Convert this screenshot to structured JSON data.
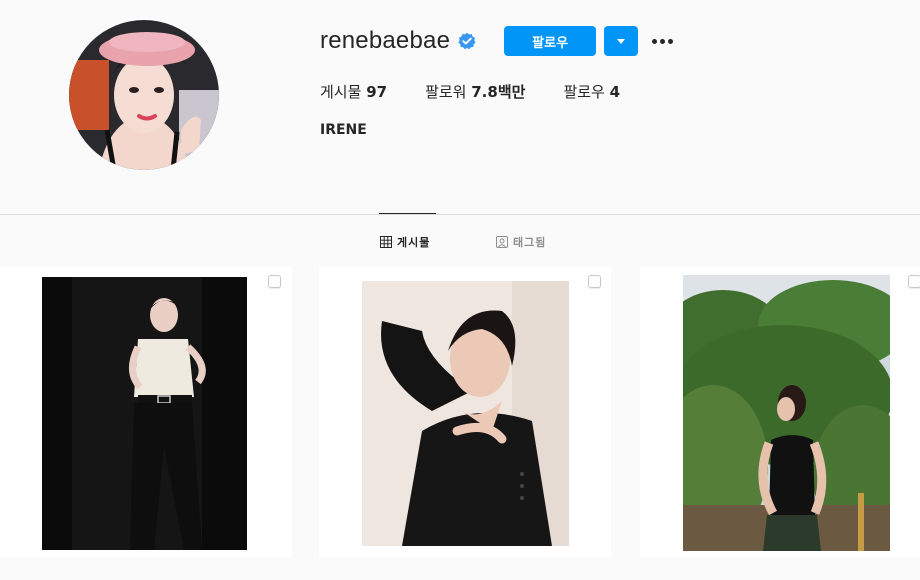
{
  "profile": {
    "username": "renebaebae",
    "verified_icon": "verified-badge-icon",
    "full_name": "IRENE",
    "follow_label": "팔로우",
    "stats": {
      "posts_label": "게시물",
      "posts_value": "97",
      "followers_label": "팔로워",
      "followers_value": "7.8백만",
      "following_label": "팔로우",
      "following_value": "4"
    }
  },
  "tabs": [
    {
      "label": "게시물",
      "icon": "grid-icon",
      "active": true
    },
    {
      "label": "태그됨",
      "icon": "tagged-icon",
      "active": false
    }
  ],
  "colors": {
    "accent": "#0095f6",
    "verified": "#3897f0",
    "background": "#fafafa",
    "divider": "#dbdbdb",
    "muted_text": "#8e8e8e"
  }
}
